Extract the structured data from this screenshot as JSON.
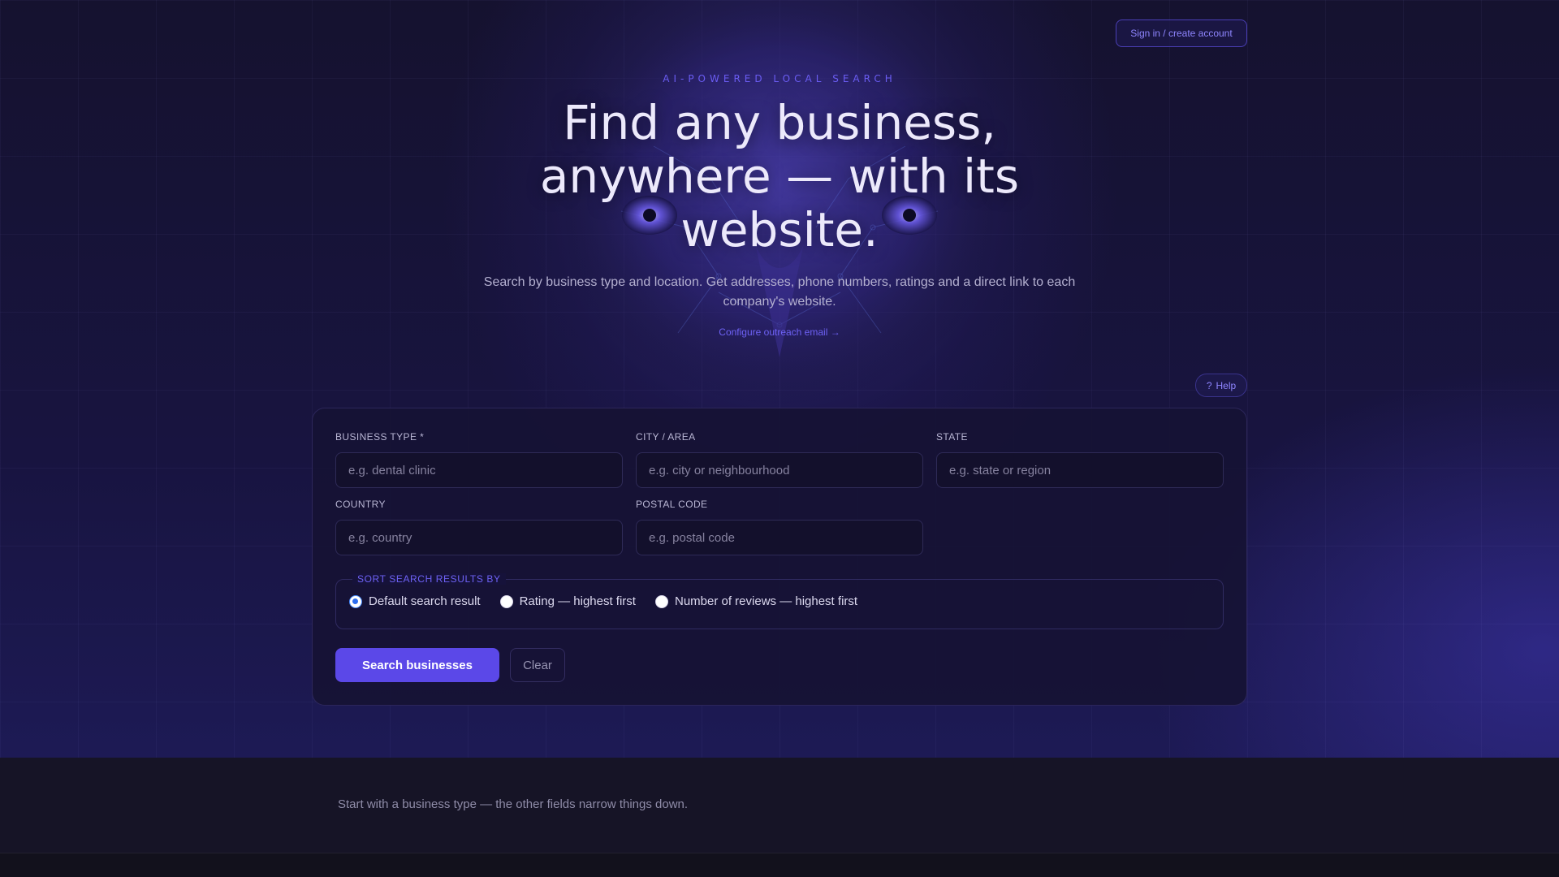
{
  "header": {
    "signin_label": "Sign in / create account"
  },
  "hero": {
    "eyebrow": "AI-POWERED LOCAL SEARCH",
    "title_line1": "Find any business,",
    "title_line2": "anywhere — with its",
    "title_line3": "website.",
    "subtitle_line1": "Search by business type and location. Get addresses, phone numbers, ratings and a direct link to each",
    "subtitle_line2": "company's website.",
    "outreach_link": "Configure outreach email →"
  },
  "help": {
    "icon": "?",
    "label": "Help"
  },
  "form": {
    "business_type": {
      "label": "BUSINESS TYPE *",
      "placeholder": "e.g. dental clinic",
      "value": ""
    },
    "city": {
      "label": "CITY / AREA",
      "placeholder": "e.g. city or neighbourhood",
      "value": ""
    },
    "state": {
      "label": "STATE",
      "placeholder": "e.g. state or region",
      "value": ""
    },
    "country": {
      "label": "COUNTRY",
      "placeholder": "e.g. country",
      "value": ""
    },
    "postal": {
      "label": "POSTAL CODE",
      "placeholder": "e.g. postal code",
      "value": ""
    },
    "sort": {
      "legend": "SORT SEARCH RESULTS BY",
      "options": [
        {
          "label": "Default search result",
          "selected": true
        },
        {
          "label": "Rating — highest first",
          "selected": false
        },
        {
          "label": "Number of reviews — highest first",
          "selected": false
        }
      ]
    },
    "search_label": "Search businesses",
    "clear_label": "Clear"
  },
  "results": {
    "hint": "Start with a business type — the other fields narrow things down."
  },
  "colors": {
    "accent": "#5b48e8",
    "link": "#6e62f5",
    "background": "#0f0d24"
  }
}
